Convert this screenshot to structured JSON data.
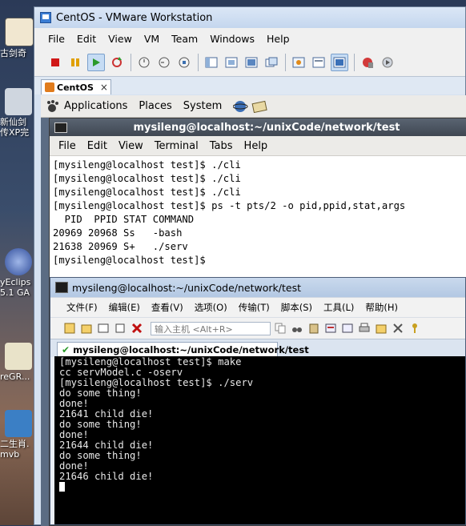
{
  "desktop": {
    "icons": [
      {
        "id": "gujian",
        "lines": [
          "古剑奇"
        ]
      },
      {
        "id": "xinxian",
        "lines": [
          "新仙剑",
          "传XP完"
        ]
      },
      {
        "id": "myeclipse",
        "lines": [
          "yEclips",
          "5.1 GA"
        ]
      },
      {
        "id": "reg",
        "lines": [
          "reGR..."
        ]
      },
      {
        "id": "rmvb",
        "lines": [
          "二生肖.",
          "mvb"
        ]
      }
    ]
  },
  "vmware": {
    "title": "CentOS - VMware Workstation",
    "menu": [
      "File",
      "Edit",
      "View",
      "VM",
      "Team",
      "Windows",
      "Help"
    ],
    "tab": {
      "label": "CentOS",
      "close": "×"
    }
  },
  "guest_panel": {
    "menus": [
      "Applications",
      "Places",
      "System"
    ]
  },
  "gnome_terminal": {
    "title": "mysileng@localhost:~/unixCode/network/test",
    "menu": [
      "File",
      "Edit",
      "View",
      "Terminal",
      "Tabs",
      "Help"
    ],
    "lines": [
      "[mysileng@localhost test]$ ./cli",
      "[mysileng@localhost test]$ ./cli",
      "[mysileng@localhost test]$ ./cli",
      "[mysileng@localhost test]$ ps -t pts/2 -o pid,ppid,stat,args",
      "  PID  PPID STAT COMMAND",
      "20969 20968 Ss   -bash",
      "21638 20969 S+   ./serv",
      "[mysileng@localhost test]$"
    ]
  },
  "xshell": {
    "title": "mysileng@localhost:~/unixCode/network/test",
    "menu": [
      "文件(F)",
      "编辑(E)",
      "查看(V)",
      "选项(O)",
      "传输(T)",
      "脚本(S)",
      "工具(L)",
      "帮助(H)"
    ],
    "address_placeholder": "输入主机 <Alt+R>",
    "tab_label": "mysileng@localhost:~/unixCode/network/test",
    "tab_check": "✔",
    "lines": [
      "[mysileng@localhost test]$ make",
      "cc servModel.c -oserv",
      "[mysileng@localhost test]$ ./serv",
      "do some thing!",
      "done!",
      "21641 child die!",
      "do some thing!",
      "done!",
      "21644 child die!",
      "do some thing!",
      "done!",
      "21646 child die!"
    ]
  },
  "colors": {
    "terminal_bg": "#000000",
    "terminal_fg": "#e8e8e8",
    "gnome_bg": "#ffffff"
  }
}
